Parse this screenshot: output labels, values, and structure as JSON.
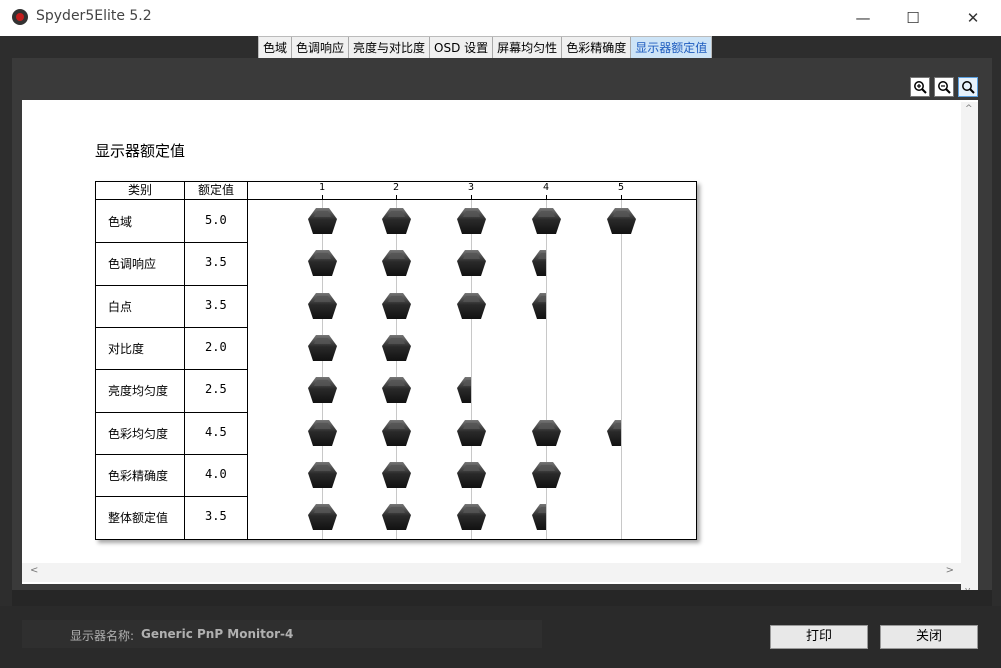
{
  "window": {
    "title": "Spyder5Elite 5.2",
    "minimize": "—",
    "maximize": "☐",
    "close": "✕"
  },
  "tabs": [
    {
      "label": "色域",
      "active": false
    },
    {
      "label": "色调响应",
      "active": false
    },
    {
      "label": "亮度与对比度",
      "active": false
    },
    {
      "label": "OSD 设置",
      "active": false
    },
    {
      "label": "屏幕均匀性",
      "active": false
    },
    {
      "label": "色彩精确度",
      "active": false
    },
    {
      "label": "显示器额定值",
      "active": true
    }
  ],
  "zoom_tools": [
    "zoom-in-icon",
    "zoom-out-icon",
    "zoom-fit-icon"
  ],
  "report": {
    "title": "显示器额定值",
    "headers": {
      "category": "类别",
      "rating": "额定值"
    },
    "scale": [
      "1",
      "2",
      "3",
      "4",
      "5"
    ],
    "rows": [
      {
        "label": "色域",
        "value": "5.0",
        "rating": 5.0
      },
      {
        "label": "色调响应",
        "value": "3.5",
        "rating": 3.5
      },
      {
        "label": "白点",
        "value": "3.5",
        "rating": 3.5
      },
      {
        "label": "对比度",
        "value": "2.0",
        "rating": 2.0
      },
      {
        "label": "亮度均匀度",
        "value": "2.5",
        "rating": 2.5
      },
      {
        "label": "色彩均匀度",
        "value": "4.5",
        "rating": 4.5
      },
      {
        "label": "色彩精确度",
        "value": "4.0",
        "rating": 4.0
      },
      {
        "label": "整体额定值",
        "value": "3.5",
        "rating": 3.5
      }
    ]
  },
  "footer": {
    "monitor_label": "显示器名称:",
    "monitor_name": "Generic PnP Monitor-4",
    "print_button": "打印",
    "close_button": "关闭"
  },
  "colors": {
    "active_tab_bg": "#cde4f7",
    "active_tab_text": "#1e5cbf",
    "gem": "#2a2a2a"
  }
}
